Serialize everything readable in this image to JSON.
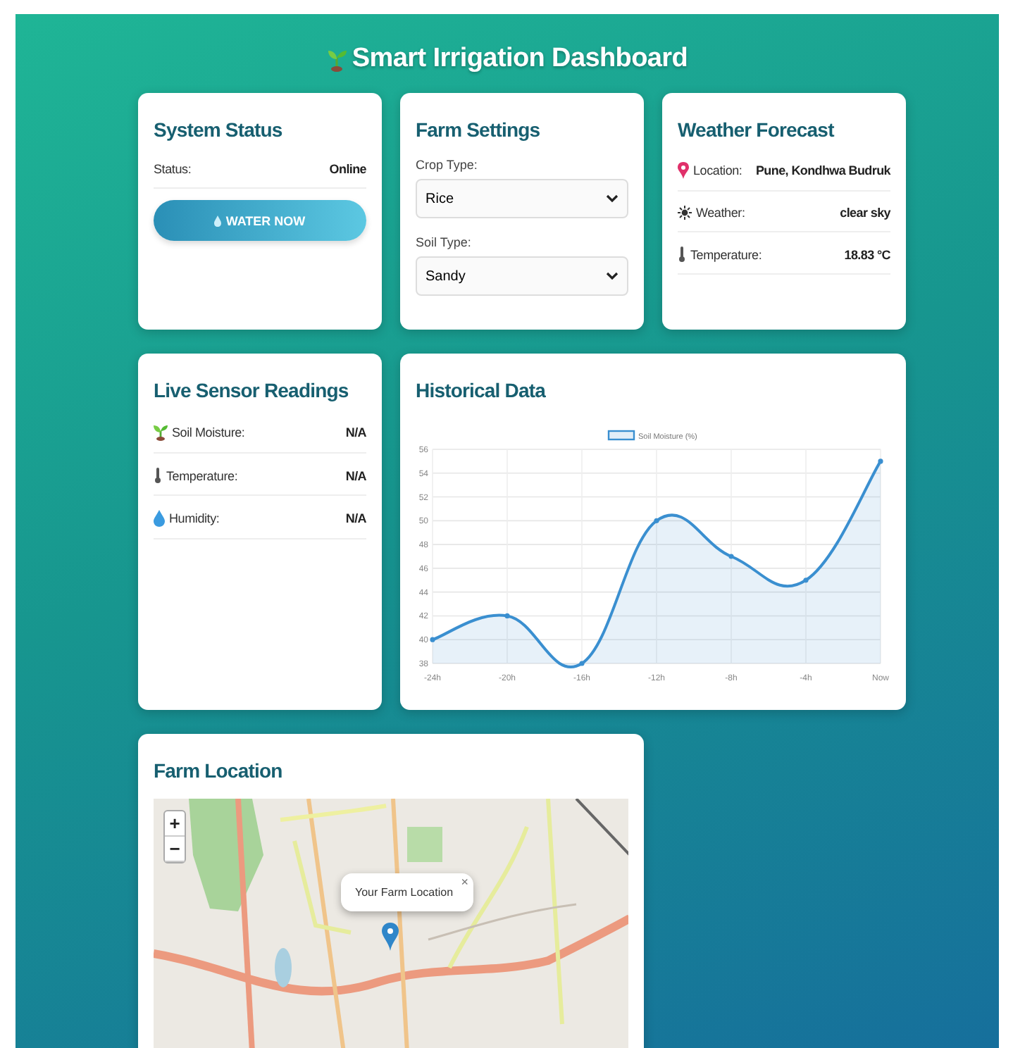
{
  "header": {
    "title": "Smart Irrigation Dashboard"
  },
  "system_status": {
    "title": "System Status",
    "rows": [
      {
        "label": "Status:",
        "value": "Online"
      }
    ],
    "button": "WATER NOW"
  },
  "farm_settings": {
    "title": "Farm Settings",
    "fields": [
      {
        "label": "Crop Type:",
        "value": "Rice"
      },
      {
        "label": "Soil Type:",
        "value": "Sandy"
      }
    ]
  },
  "weather": {
    "title": "Weather Forecast",
    "rows": [
      {
        "kind": "location",
        "label": "Location:",
        "value": "Pune, Kondhwa Budruk"
      },
      {
        "kind": "weather",
        "label": "Weather:",
        "value": "clear sky"
      },
      {
        "kind": "temperature",
        "label": "Temperature:",
        "value": "18.83 °C"
      }
    ]
  },
  "live_sensors": {
    "title": "Live Sensor Readings",
    "rows": [
      {
        "kind": "soil",
        "label": "Soil Moisture:",
        "value": "N/A"
      },
      {
        "kind": "temperature",
        "label": "Temperature:",
        "value": "N/A"
      },
      {
        "kind": "humidity",
        "label": "Humidity:",
        "value": "N/A"
      }
    ]
  },
  "historical": {
    "title": "Historical Data",
    "chart_data": {
      "type": "area",
      "categories": [
        "-24h",
        "-20h",
        "-16h",
        "-12h",
        "-8h",
        "-4h",
        "Now"
      ],
      "series": [
        {
          "name": "Soil Moisture (%)",
          "color": "#3a8fd0",
          "values": [
            40,
            42,
            38,
            50,
            47,
            45,
            55
          ]
        }
      ],
      "grid": true,
      "ylim": [
        38,
        56
      ],
      "yticks": [
        38,
        40,
        42,
        44,
        46,
        48,
        50,
        52,
        54,
        56
      ]
    }
  },
  "farm_location": {
    "title": "Farm Location",
    "zoom_in": "+",
    "zoom_out": "−",
    "popup": {
      "text": "Your Farm Location",
      "close": "×"
    }
  }
}
